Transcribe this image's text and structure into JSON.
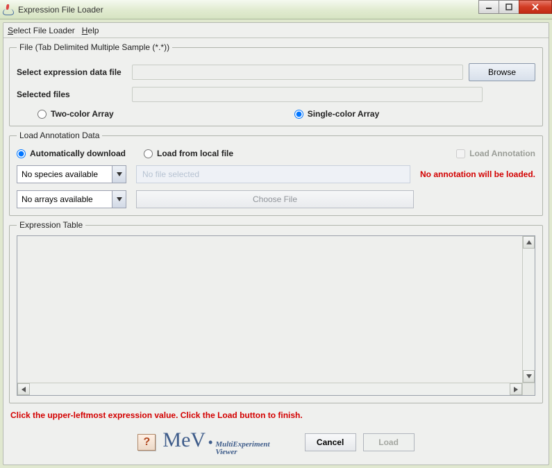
{
  "window": {
    "title": "Expression File Loader"
  },
  "menu": {
    "select_file_loader": "Select File Loader",
    "help": "Help"
  },
  "file_group": {
    "legend": "File    (Tab Delimited Multiple Sample (*.*))",
    "select_label": "Select expression data file",
    "selected_label": "Selected files",
    "browse": "Browse",
    "two_color": "Two-color Array",
    "single_color": "Single-color Array"
  },
  "ann_group": {
    "legend": "Load Annotation Data",
    "auto": "Automatically download",
    "local": "Load from local file",
    "load_ann": "Load Annotation",
    "species": "No species available",
    "arrays": "No arrays available",
    "no_file": "No file selected",
    "choose": "Choose File",
    "warn": "No annotation will be loaded."
  },
  "table_group": {
    "legend": "Expression Table"
  },
  "hint": "Click the upper-leftmost expression value. Click the Load button to finish.",
  "footer": {
    "mev": "MeV",
    "sub1": "MultiExperiment",
    "sub2": "Viewer",
    "cancel": "Cancel",
    "load": "Load"
  }
}
